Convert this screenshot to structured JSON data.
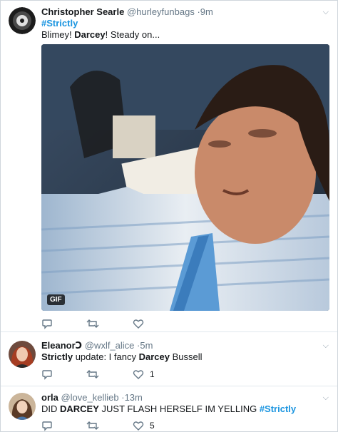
{
  "tweets": [
    {
      "name": "Christopher Searle",
      "handle": "@hurleyfunbags",
      "time": "·9m",
      "hashtag": "#Strictly",
      "text_a": "Blimey! ",
      "text_bold": "Darcey",
      "text_b": "! Steady on...",
      "media_badge": "GIF",
      "reply_count": "",
      "retweet_count": "",
      "like_count": ""
    },
    {
      "name": "EleanorↃ",
      "handle": "@wxlf_alice",
      "time": "·5m",
      "text_bold1": "Strictly",
      "text_a": " update: I fancy ",
      "text_bold2": "Darcey",
      "text_b": " Bussell",
      "reply_count": "",
      "retweet_count": "",
      "like_count": "1"
    },
    {
      "name": "orla",
      "handle": "@love_kellieb",
      "time": "·13m",
      "text_a": "DID ",
      "text_bold": "DARCEY",
      "text_b": " JUST FLASH HERSELF IM YELLING ",
      "hashtag": "#Strictly",
      "reply_count": "",
      "retweet_count": "",
      "like_count": "5"
    }
  ],
  "icons": {
    "more": "chevron-down-icon",
    "reply": "reply-icon",
    "retweet": "retweet-icon",
    "like": "heart-icon"
  },
  "colors": {
    "link": "#1b95e0",
    "muted": "#657786",
    "divider": "#e1e8ed"
  }
}
